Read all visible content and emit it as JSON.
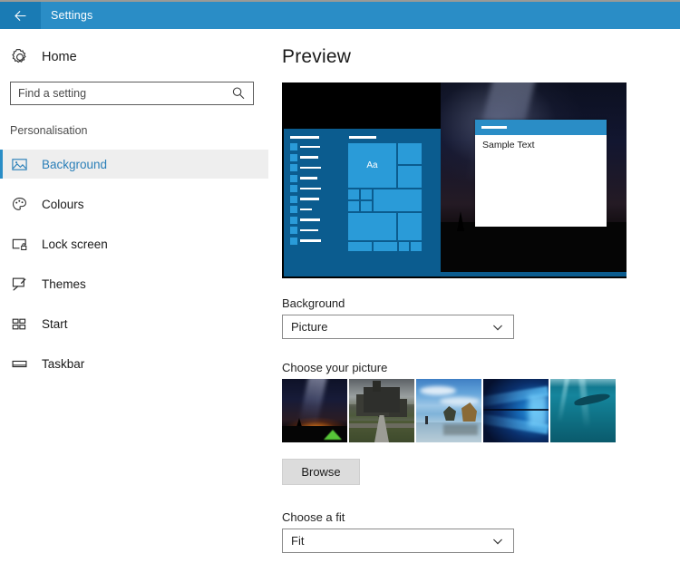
{
  "window": {
    "title": "Settings",
    "back_icon": "back-arrow-icon",
    "accent_color": "#2a8dc6",
    "back_button_color": "#1a7bb4"
  },
  "sidebar": {
    "home": {
      "label": "Home",
      "icon": "gear-icon"
    },
    "search": {
      "placeholder": "Find a setting",
      "value": "",
      "icon": "search-icon"
    },
    "section_label": "Personalisation",
    "items": [
      {
        "label": "Background",
        "icon": "picture-icon",
        "selected": true
      },
      {
        "label": "Colours",
        "icon": "palette-icon",
        "selected": false
      },
      {
        "label": "Lock screen",
        "icon": "lock-screen-icon",
        "selected": false
      },
      {
        "label": "Themes",
        "icon": "themes-brush-icon",
        "selected": false
      },
      {
        "label": "Start",
        "icon": "start-tiles-icon",
        "selected": false
      },
      {
        "label": "Taskbar",
        "icon": "taskbar-icon",
        "selected": false
      }
    ],
    "selected_text_color": "#2a7fb8",
    "selected_bar_color": "#2a8dc6"
  },
  "main": {
    "page_title": "Preview",
    "preview": {
      "sample_window_text": "Sample Text",
      "tile_text": "Aa",
      "start_menu_color": "#0b5c8f",
      "tile_color": "#2a9bd8",
      "window_titlebar_color": "#2a8dc6"
    },
    "background_section": {
      "label": "Background",
      "selected_value": "Picture",
      "chevron_icon": "chevron-down-icon"
    },
    "picture_section": {
      "label": "Choose your picture",
      "thumbnails": [
        {
          "name": "night-sky-tent-thumbnail"
        },
        {
          "name": "castle-path-thumbnail"
        },
        {
          "name": "beach-sea-stacks-thumbnail"
        },
        {
          "name": "windows-hero-thumbnail"
        },
        {
          "name": "underwater-thumbnail"
        }
      ],
      "browse_label": "Browse"
    },
    "fit_section": {
      "label": "Choose a fit",
      "selected_value": "Fit",
      "chevron_icon": "chevron-down-icon"
    }
  }
}
